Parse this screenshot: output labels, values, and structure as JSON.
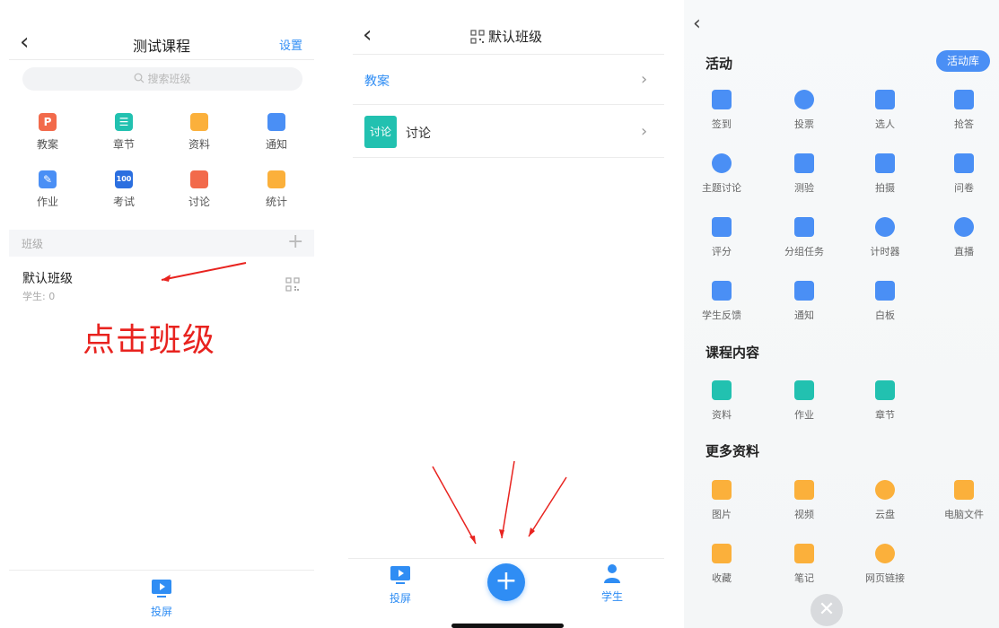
{
  "screen1": {
    "back_glyph": "‹",
    "title": "测试课程",
    "settings_label": "设置",
    "search_placeholder": "搜索班级",
    "grid": [
      {
        "label": "教案",
        "icon": "lesson-plan-icon",
        "color": "#f26a4b",
        "glyph": "P"
      },
      {
        "label": "章节",
        "icon": "chapter-list-icon",
        "color": "#22c1b0",
        "glyph": "☰"
      },
      {
        "label": "资料",
        "icon": "folder-icon",
        "color": "#fbb03b",
        "glyph": ""
      },
      {
        "label": "通知",
        "icon": "speaker-icon",
        "color": "#4a8ff5",
        "glyph": ""
      },
      {
        "label": "作业",
        "icon": "homework-edit-icon",
        "color": "#4a8ff5",
        "glyph": "✎"
      },
      {
        "label": "考试",
        "icon": "exam-100-icon",
        "color": "#2b6fe0",
        "glyph": "100"
      },
      {
        "label": "讨论",
        "icon": "chat-bubble-icon",
        "color": "#f26a4b",
        "glyph": ""
      },
      {
        "label": "统计",
        "icon": "pie-chart-icon",
        "color": "#fbb03b",
        "glyph": ""
      }
    ],
    "section_title": "班级",
    "section_add": "+",
    "class_name": "默认班级",
    "class_count": "学生: 0",
    "annotation": "点击班级",
    "cast_label": "投屏"
  },
  "screen2": {
    "back_glyph": "‹",
    "title": "默认班级",
    "lesson_label": "教案",
    "arrow_glyph": "›",
    "discussion_badge": "讨论",
    "discussion_label": "讨论",
    "fab_glyph": "+",
    "tab_cast_label": "投屏",
    "tab_students_label": "学生"
  },
  "screen3": {
    "back_glyph": "‹",
    "section_activities": "活动",
    "library_button": "活动库",
    "activities": [
      {
        "label": "签到",
        "icon": "tap-checkin-icon",
        "color": "#4a8ff5"
      },
      {
        "label": "投票",
        "icon": "vote-chart-icon",
        "color": "#4a8ff5"
      },
      {
        "label": "选人",
        "icon": "pick-person-icon",
        "color": "#4a8ff5"
      },
      {
        "label": "抢答",
        "icon": "microphone-icon",
        "color": "#4a8ff5"
      },
      {
        "label": "主题讨论",
        "icon": "topic-chat-icon",
        "color": "#4a8ff5"
      },
      {
        "label": "测验",
        "icon": "quiz-doc-icon",
        "color": "#4a8ff5"
      },
      {
        "label": "拍摄",
        "icon": "camera-icon",
        "color": "#4a8ff5"
      },
      {
        "label": "问卷",
        "icon": "questionnaire-icon",
        "color": "#4a8ff5"
      },
      {
        "label": "评分",
        "icon": "lotus-rating-icon",
        "color": "#4a8ff5"
      },
      {
        "label": "分组任务",
        "icon": "group-task-icon",
        "color": "#4a8ff5"
      },
      {
        "label": "计时器",
        "icon": "timer-icon",
        "color": "#4a8ff5"
      },
      {
        "label": "直播",
        "icon": "live-play-icon",
        "color": "#4a8ff5"
      },
      {
        "label": "学生反馈",
        "icon": "feedback-icon",
        "color": "#4a8ff5"
      },
      {
        "label": "通知",
        "icon": "speaker-icon",
        "color": "#4a8ff5"
      },
      {
        "label": "白板",
        "icon": "whiteboard-icon",
        "color": "#4a8ff5"
      }
    ],
    "section_course": "课程内容",
    "course": [
      {
        "label": "资料",
        "icon": "folder-icon",
        "color": "#22c1b0"
      },
      {
        "label": "作业",
        "icon": "homework-edit-icon",
        "color": "#22c1b0"
      },
      {
        "label": "章节",
        "icon": "chapter-list-icon",
        "color": "#22c1b0"
      }
    ],
    "section_more": "更多资料",
    "more": [
      {
        "label": "图片",
        "icon": "image-icon",
        "color": "#fbb03b"
      },
      {
        "label": "视频",
        "icon": "video-icon",
        "color": "#fbb03b"
      },
      {
        "label": "云盘",
        "icon": "cloud-icon",
        "color": "#fbb03b"
      },
      {
        "label": "电脑文件",
        "icon": "computer-file-icon",
        "color": "#fbb03b"
      },
      {
        "label": "收藏",
        "icon": "favorites-icon",
        "color": "#fbb03b"
      },
      {
        "label": "笔记",
        "icon": "notes-icon",
        "color": "#fbb03b"
      },
      {
        "label": "网页链接",
        "icon": "web-link-icon",
        "color": "#fbb03b"
      }
    ],
    "close_glyph": "✕"
  },
  "colors": {
    "primary_blue": "#2f8df4",
    "annotation_red": "#e8231f",
    "teal": "#22c1b0",
    "orange": "#fbb03b"
  }
}
